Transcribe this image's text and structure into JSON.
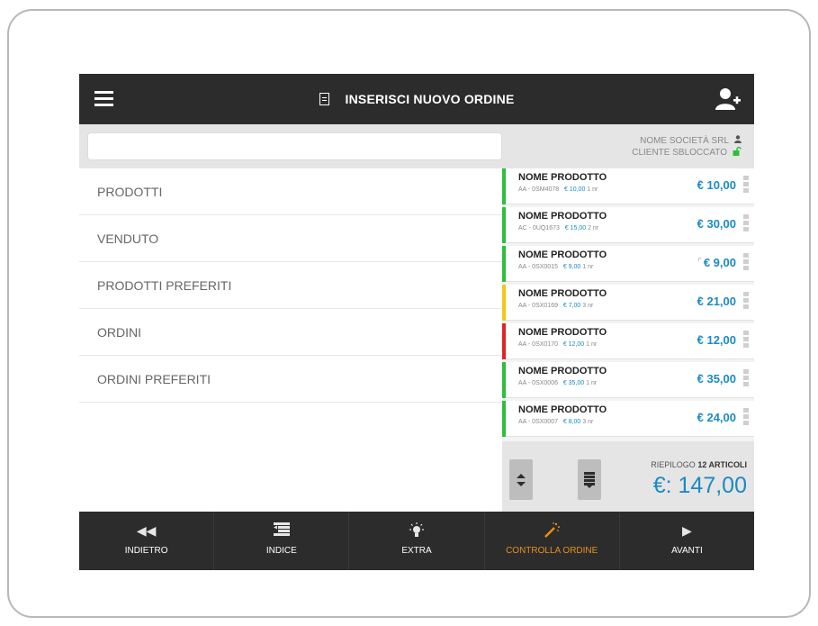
{
  "header": {
    "title": "INSERISCI NUOVO ORDINE"
  },
  "search": {
    "value": "",
    "placeholder": ""
  },
  "customer": {
    "name": "NOME SOCIETÀ SRL",
    "status": "CLIENTE SBLOCCATO"
  },
  "menu": {
    "items": [
      {
        "label": "PRODOTTI"
      },
      {
        "label": "VENDUTO"
      },
      {
        "label": "PRODOTTI PREFERITI"
      },
      {
        "label": "ORDINI"
      },
      {
        "label": "ORDINI PREFERITI"
      }
    ]
  },
  "products": [
    {
      "name": "NOME PRODOTTO",
      "code": "AA - 0SM4078",
      "unit_price": "€ 10,00",
      "qty": "1 nr",
      "price": "€ 10,00",
      "status_color": "#2dbf3a"
    },
    {
      "name": "NOME PRODOTTO",
      "code": "AC - 0UQ1673",
      "unit_price": "€ 15,00",
      "qty": "2 nr",
      "price": "€ 30,00",
      "status_color": "#2dbf3a"
    },
    {
      "name": "NOME PRODOTTO",
      "code": "AA - 0SX0015",
      "unit_price": "€ 9,00",
      "qty": "1 nr",
      "price": "€ 9,00",
      "status_color": "#2dbf3a"
    },
    {
      "name": "NOME PRODOTTO",
      "code": "AA - 0SX0169",
      "unit_price": "€ 7,00",
      "qty": "3 nr",
      "price": "€ 21,00",
      "status_color": "#f5c518"
    },
    {
      "name": "NOME PRODOTTO",
      "code": "AA - 0SX0170",
      "unit_price": "€ 12,00",
      "qty": "1 nr",
      "price": "€ 12,00",
      "status_color": "#e02424"
    },
    {
      "name": "NOME PRODOTTO",
      "code": "AA - 0SX0006",
      "unit_price": "€ 35,00",
      "qty": "1 nr",
      "price": "€ 35,00",
      "status_color": "#2dbf3a"
    },
    {
      "name": "NOME PRODOTTO",
      "code": "AA - 0SX0007",
      "unit_price": "€ 8,00",
      "qty": "3 nr",
      "price": "€ 24,00",
      "status_color": "#2dbf3a"
    }
  ],
  "summary": {
    "label": "RIEPILOGO",
    "count_label": "12 ARTICOLI",
    "total": "€: 147,00"
  },
  "nav": {
    "items": [
      {
        "label": "INDIETRO",
        "icon": "rewind-icon"
      },
      {
        "label": "INDICE",
        "icon": "list-icon"
      },
      {
        "label": "EXTRA",
        "icon": "lightbulb-icon"
      },
      {
        "label": "CONTROLLA ORDINE",
        "icon": "magic-wand-icon",
        "active": true
      },
      {
        "label": "AVANTI",
        "icon": "play-icon"
      }
    ]
  },
  "colors": {
    "accent": "#1a8ac3",
    "active": "#e8901e",
    "dark": "#2c2c2c"
  }
}
